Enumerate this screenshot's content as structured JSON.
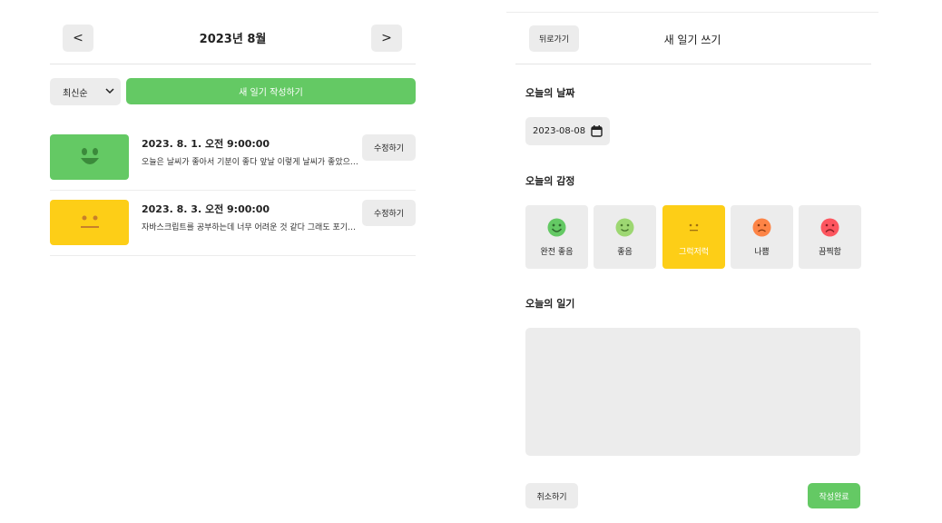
{
  "list": {
    "header": {
      "prev_label": "<",
      "next_label": ">",
      "title": "2023년 8월"
    },
    "sort": {
      "selected": "최신순"
    },
    "new_button_label": "새 일기 작성하기",
    "entries": [
      {
        "date": "2023. 8. 1. 오전 9:00:00",
        "excerpt": "오늘은 날씨가 좋아서 기분이 좋다 앞날 이렇게 날씨가 좋았으면 좋...",
        "edit_label": "수정하기",
        "emotion": "very-good",
        "color": "#64c964"
      },
      {
        "date": "2023. 8. 3. 오전 9:00:00",
        "excerpt": "자바스크립트를 공부하는데 너무 어려운 것 같다 그래도 포기하지 않...",
        "edit_label": "수정하기",
        "emotion": "neutral",
        "color": "#fdce17"
      }
    ]
  },
  "editor": {
    "back_label": "뒤로가기",
    "title": "새 일기 쓰기",
    "date_section_label": "오늘의 날짜",
    "date_value": "2023-08-08",
    "emotion_section_label": "오늘의 감정",
    "emotions": [
      {
        "label": "완전 좋음",
        "color": "#64c964",
        "icon": "very-happy-face-icon"
      },
      {
        "label": "좋음",
        "color": "#9dd772",
        "icon": "happy-face-icon"
      },
      {
        "label": "그럭저럭",
        "color": "#fdce17",
        "icon": "neutral-face-icon",
        "selected": true
      },
      {
        "label": "나쁨",
        "color": "#fd8446",
        "icon": "sad-face-icon"
      },
      {
        "label": "끔찍함",
        "color": "#fd565f",
        "icon": "very-sad-face-icon"
      }
    ],
    "diary_section_label": "오늘의 일기",
    "diary_placeholder": "",
    "cancel_label": "취소하기",
    "submit_label": "작성완료"
  }
}
